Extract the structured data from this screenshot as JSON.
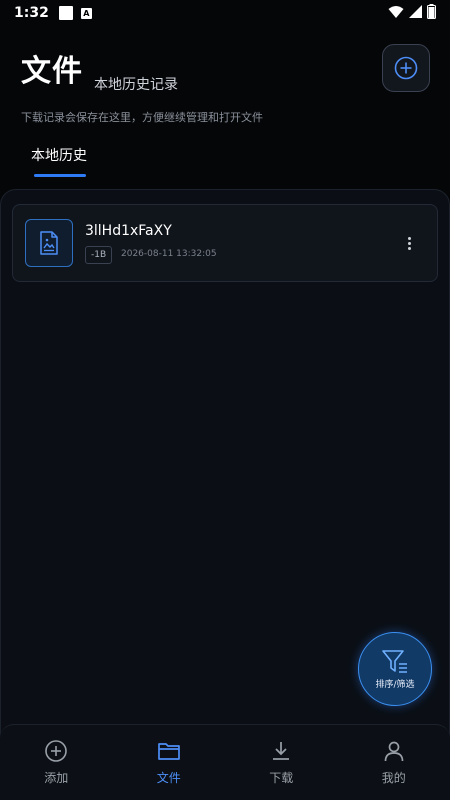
{
  "status_bar": {
    "time": "1:32",
    "a_badge": "A"
  },
  "header": {
    "title": "文件",
    "subtitle": "本地历史记录",
    "description": "下载记录会保存在这里，方便继续管理和打开文件"
  },
  "tabs": [
    {
      "label": "本地历史",
      "active": true
    }
  ],
  "files": [
    {
      "name": "3llHd1xFaXY",
      "size": "-1B",
      "time": "2026-08-11 13:32:05"
    }
  ],
  "fab": {
    "label": "排序/筛选"
  },
  "bottom_nav": [
    {
      "label": "添加",
      "icon": "plus-circle-icon",
      "active": false
    },
    {
      "label": "文件",
      "icon": "folder-icon",
      "active": true
    },
    {
      "label": "下载",
      "icon": "download-icon",
      "active": false
    },
    {
      "label": "我的",
      "icon": "user-icon",
      "active": false
    }
  ],
  "colors": {
    "accent": "#2f7bf5",
    "background": "#050608",
    "panel": "#0b0f15"
  }
}
